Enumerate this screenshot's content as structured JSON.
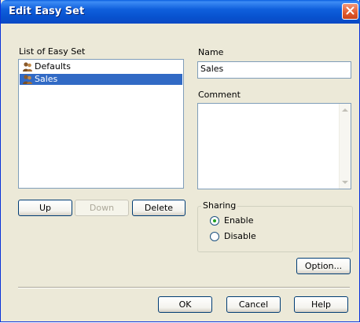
{
  "window": {
    "title": "Edit Easy Set"
  },
  "list_section": {
    "label": "List of Easy Set",
    "items": [
      {
        "label": "Defaults",
        "selected": false,
        "icon": "users-icon"
      },
      {
        "label": "Sales",
        "selected": true,
        "icon": "users-icon"
      }
    ]
  },
  "list_buttons": {
    "up": "Up",
    "down": "Down",
    "delete": "Delete"
  },
  "name": {
    "label": "Name",
    "value": "Sales"
  },
  "comment": {
    "label": "Comment",
    "value": ""
  },
  "sharing": {
    "label": "Sharing",
    "enable": "Enable",
    "disable": "Disable",
    "selected": "Enable"
  },
  "buttons": {
    "option": "Option...",
    "ok": "OK",
    "cancel": "Cancel",
    "help": "Help"
  },
  "colors": {
    "titlebar": "#0853d0",
    "selection": "#316ac5",
    "close": "#e35a2d"
  }
}
